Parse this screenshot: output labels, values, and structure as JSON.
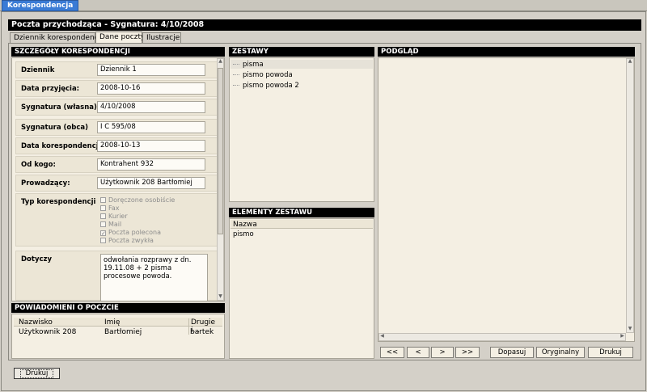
{
  "app_tab": "Korespondencja",
  "window_title": "Poczta przychodząca - Sygnatura: 4/10/2008",
  "tabs": [
    {
      "label": "Dziennik korespondencji"
    },
    {
      "label": "Dane poczty"
    },
    {
      "label": "Ilustracje"
    }
  ],
  "details": {
    "header": "SZCZEGÓŁY KORESPONDENCJI",
    "fields": [
      {
        "label": "Dziennik",
        "value": "Dziennik 1"
      },
      {
        "label": "Data przyjęcia:",
        "value": "2008-10-16"
      },
      {
        "label": "Sygnatura (własna)",
        "value": "4/10/2008"
      },
      {
        "label": "Sygnatura (obca)",
        "value": "I C 595/08"
      },
      {
        "label": "Data korespondencji",
        "value": "2008-10-13"
      },
      {
        "label": "Od kogo:",
        "value": "Kontrahent 932"
      },
      {
        "label": "Prowadzący:",
        "value": "Użytkownik 208 Bartłomiej"
      }
    ],
    "type_label": "Typ korespondencji",
    "type_options": [
      {
        "label": "Doręczone osobiście",
        "checked": false
      },
      {
        "label": "Fax",
        "checked": false
      },
      {
        "label": "Kurier",
        "checked": false
      },
      {
        "label": "Mail",
        "checked": false
      },
      {
        "label": "Poczta polecona",
        "checked": true
      },
      {
        "label": "Poczta zwykła",
        "checked": false
      }
    ],
    "dotyczy_label": "Dotyczy",
    "dotyczy_value": "odwołania rozprawy z dn. 19.11.08 + 2 pisma procesowe powoda."
  },
  "notifications": {
    "header": "POWIADOMIENI O POCZCIE",
    "columns": [
      "Nazwisko",
      "Imię",
      "Drugie i..."
    ],
    "rows": [
      [
        "Użytkownik 208",
        "Bartłomiej",
        "bartek"
      ]
    ]
  },
  "sets": {
    "header": "ZESTAWY",
    "items": [
      "pisma",
      "pismo powoda",
      "pismo powoda 2"
    ]
  },
  "set_elements": {
    "header": "ELEMENTY ZESTAWU",
    "column": "Nazwa",
    "rows": [
      "pismo"
    ]
  },
  "preview": {
    "header": "PODGLĄD",
    "nav_first": "<<",
    "nav_prev": "<",
    "nav_next": ">",
    "nav_last": ">>",
    "fit": "Dopasuj",
    "original": "Oryginalny",
    "print": "Drukuj"
  },
  "bottom_print": "Drukuj"
}
